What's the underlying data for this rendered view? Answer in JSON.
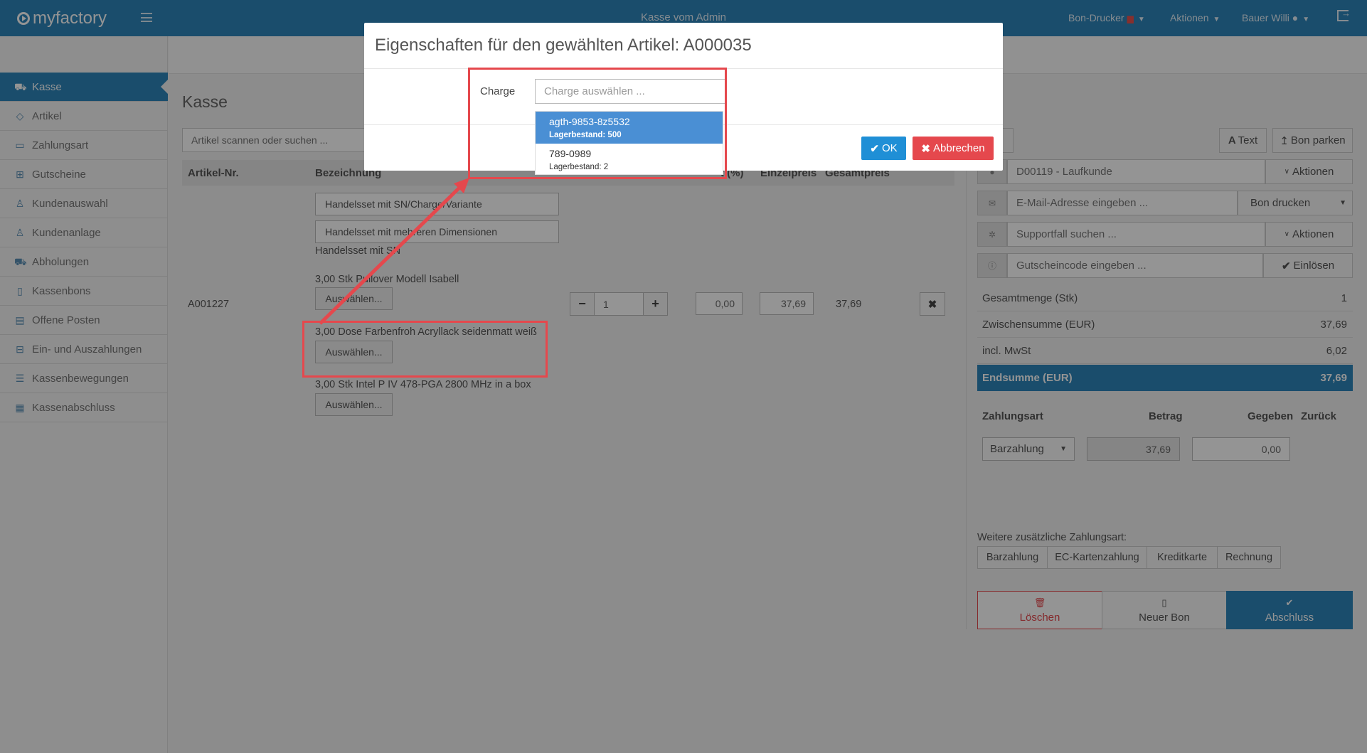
{
  "header": {
    "logo": "myfactory",
    "title": "Kasse vom Admin",
    "printer_menu": "Bon-Drucker",
    "actions_menu": "Aktionen",
    "user_menu": "Bauer Willi"
  },
  "sidebar": {
    "items": [
      {
        "label": "Kasse",
        "icon": "cart-icon",
        "active": true
      },
      {
        "label": "Artikel",
        "icon": "tag-icon",
        "active": false
      },
      {
        "label": "Zahlungsart",
        "icon": "wallet-icon",
        "active": false
      },
      {
        "label": "Gutscheine",
        "icon": "gift-icon",
        "active": false
      },
      {
        "label": "Kundenauswahl",
        "icon": "user-icon",
        "active": false
      },
      {
        "label": "Kundenanlage",
        "icon": "user-add-icon",
        "active": false
      },
      {
        "label": "Abholungen",
        "icon": "cart-pickup-icon",
        "active": false
      },
      {
        "label": "Kassenbons",
        "icon": "receipt-icon",
        "active": false
      },
      {
        "label": "Offene Posten",
        "icon": "book-icon",
        "active": false
      },
      {
        "label": "Ein- und Auszahlungen",
        "icon": "inbox-icon",
        "active": false
      },
      {
        "label": "Kassenbewegungen",
        "icon": "list-icon",
        "active": false
      },
      {
        "label": "Kassenabschluss",
        "icon": "calculator-icon",
        "active": false
      }
    ]
  },
  "main": {
    "title": "Kasse",
    "search_placeholder": "Artikel scannen oder suchen ...",
    "columns": {
      "article_no": "Artikel-Nr.",
      "description": "Bezeichnung",
      "discount": "t (%)",
      "unit_price": "Einzelpreis",
      "total_price": "Gesamtpreis"
    },
    "option_sn": "Handelsset mit SN/Charge/Variante",
    "option_dims": "Handelsset mit mehreren Dimensionen",
    "set_name": "Handelsset mit SN",
    "line1": "3,00 Stk Pullover Modell Isabell",
    "line2": "3,00 Dose Farbenfroh Acryllack seidenmatt weiß",
    "line3": "3,00 Stk Intel P IV 478-PGA 2800 MHz in a box",
    "select_label": "Auswählen...",
    "row": {
      "article_no": "A001227",
      "quantity": "1",
      "discount": "0,00",
      "unit_price": "37,69",
      "total_price": "37,69"
    }
  },
  "right": {
    "text_button": "Text",
    "park_button": "Bon parken",
    "customer": "D00119 - Laufkunde",
    "actions": "Aktionen",
    "email_placeholder": "E-Mail-Adresse eingeben ...",
    "print_receipt": "Bon drucken",
    "support_placeholder": "Supportfall suchen ...",
    "voucher_placeholder": "Gutscheincode eingeben ...",
    "redeem": "Einlösen",
    "summary": [
      {
        "label": "Gesamtmenge (Stk)",
        "value": "1"
      },
      {
        "label": "Zwischensumme (EUR)",
        "value": "37,69"
      },
      {
        "label": "incl. MwSt",
        "value": "6,02"
      }
    ],
    "total_label": "Endsumme (EUR)",
    "total_value": "37,69",
    "payment_headers": {
      "method": "Zahlungsart",
      "amount": "Betrag",
      "given": "Gegeben",
      "change": "Zurück"
    },
    "payment_method": "Barzahlung",
    "payment_amount": "37,69",
    "payment_given": "0,00",
    "more_payment_label": "Weitere zusätzliche Zahlungsart:",
    "payment_options": [
      "Barzahlung",
      "EC-Kartenzahlung",
      "Kreditkarte",
      "Rechnung"
    ],
    "delete_button": "Löschen",
    "new_button": "Neuer Bon",
    "finish_button": "Abschluss"
  },
  "modal": {
    "title": "Eigenschaften für den gewählten Artikel: A000035",
    "charge_label": "Charge",
    "charge_placeholder": "Charge auswählen ...",
    "options": [
      {
        "name": "agth-9853-8z5532",
        "stock": "Lagerbestand: 500"
      },
      {
        "name": "789-0989",
        "stock": "Lagerbestand: 2"
      }
    ],
    "ok": "OK",
    "cancel": "Abbrechen"
  },
  "colors": {
    "primary": "#2e86ba",
    "danger": "#e5484d",
    "ok_blue": "#1f8fd6",
    "dropdown_selected": "#4a8fd4"
  }
}
